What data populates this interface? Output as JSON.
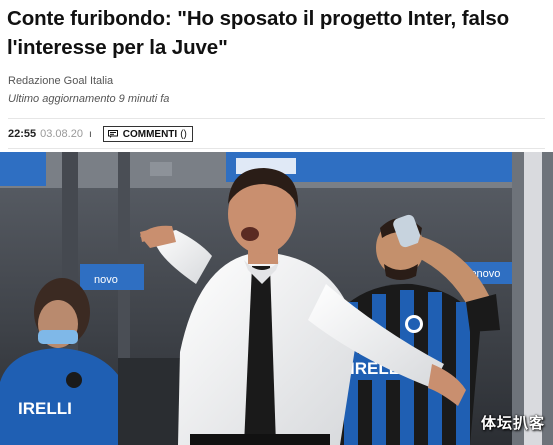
{
  "article": {
    "title_line1": "Conte furibondo: \"Ho sposato il progetto Inter, falso",
    "title_line2": "l'interesse per la Juve\"",
    "author": "Redazione Goal Italia",
    "updated": "Ultimo aggiornamento 9 minuti fa",
    "time": "22:55",
    "date": "03.08.20",
    "separator": "ı",
    "comments_label": "COMMENTI",
    "comments_count": "()"
  },
  "photo": {
    "watermark": "体坛扒客",
    "banner_text": "novo",
    "sponsor_text": "IRELLI",
    "icons": [
      "comment-icon"
    ]
  },
  "colors": {
    "text": "#111111",
    "muted": "#555555",
    "date": "#999999",
    "inter_blue": "#1f5fb3",
    "stadium_blue": "#2f6fc2"
  }
}
